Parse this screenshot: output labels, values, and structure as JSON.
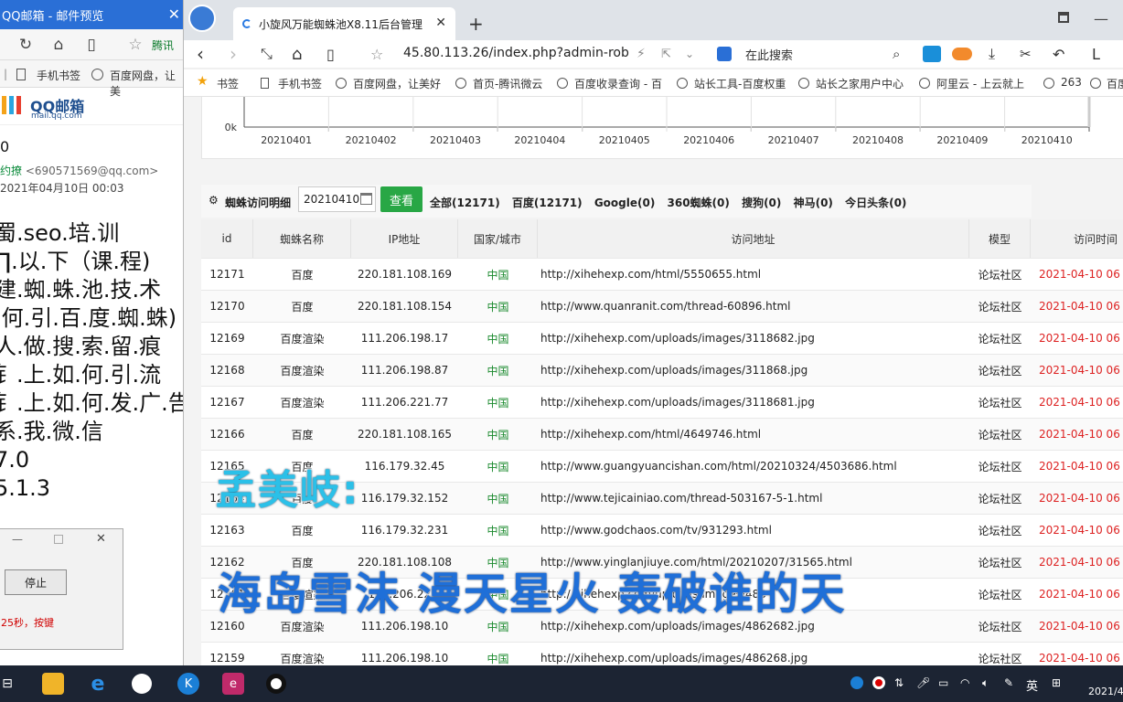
{
  "left_window": {
    "title": "QQ邮箱 - 邮件预览",
    "brand_cn": "QQ邮箱",
    "brand_url": "mail.qq.com",
    "bookmarks": [
      "手机书签",
      "百度网盘，让美"
    ],
    "fav_label": "腾讯",
    "subject_prefix": "0",
    "sender_name": "约撩",
    "sender_email": "<690571569@qq.com>",
    "date": "2021年04月10日 00:03",
    "body_lines": [
      "蜀.seo.培.训",
      "∏.以.下（课.程)",
      "建.蜘.蛛.池.技.术",
      ".何.引.百.度.蜘.蛛)",
      "人.做.搜.索.留.痕",
      "钅.上.如.何.引.流",
      "钅.上.如.何.发.广.告",
      "系.我.微.信",
      "7.0",
      "5.1.3"
    ],
    "dialog_button": "停止",
    "dialog_message": "25秒，按键"
  },
  "browser": {
    "tab_title": "小旋风万能蜘蛛池X8.11后台管理",
    "url": "45.80.113.26/index.php?admin-rob",
    "search_placeholder": "在此搜索",
    "bookmarks_label": "书签",
    "bookmarks": [
      "手机书签",
      "百度网盘，让美好",
      "首页-腾讯微云",
      "百度收录查询 - 百",
      "站长工具-百度权重",
      "站长之家用户中心",
      "阿里云 - 上云就上",
      "263",
      "百度"
    ]
  },
  "chart": {
    "y_tick": "0k",
    "x_labels": [
      "20210401",
      "20210402",
      "20210403",
      "20210404",
      "20210405",
      "20210406",
      "20210407",
      "20210408",
      "20210409",
      "20210410"
    ]
  },
  "toolbar": {
    "title": "蜘蛛访问明细",
    "date_value": "20210410",
    "view_button": "查看",
    "filters": [
      "全部(12171)",
      "百度(12171)",
      "Google(0)",
      "360蜘蛛(0)",
      "搜狗(0)",
      "神马(0)",
      "今日头条(0)"
    ]
  },
  "table": {
    "headers": [
      "id",
      "蜘蛛名称",
      "IP地址",
      "国家/城市",
      "访问地址",
      "模型",
      "访问时间"
    ],
    "rows": [
      [
        "12171",
        "百度",
        "220.181.108.169",
        "中国",
        "http://xihehexp.com/html/5550655.html",
        "论坛社区",
        "2021-04-10 06"
      ],
      [
        "12170",
        "百度",
        "220.181.108.154",
        "中国",
        "http://www.quanranit.com/thread-60896.html",
        "论坛社区",
        "2021-04-10 06"
      ],
      [
        "12169",
        "百度渲染",
        "111.206.198.17",
        "中国",
        "http://xihehexp.com/uploads/images/3118682.jpg",
        "论坛社区",
        "2021-04-10 06"
      ],
      [
        "12168",
        "百度渲染",
        "111.206.198.87",
        "中国",
        "http://xihehexp.com/uploads/images/311868.jpg",
        "论坛社区",
        "2021-04-10 06"
      ],
      [
        "12167",
        "百度渲染",
        "111.206.221.77",
        "中国",
        "http://xihehexp.com/uploads/images/3118681.jpg",
        "论坛社区",
        "2021-04-10 06"
      ],
      [
        "12166",
        "百度",
        "220.181.108.165",
        "中国",
        "http://xihehexp.com/html/4649746.html",
        "论坛社区",
        "2021-04-10 06"
      ],
      [
        "12165",
        "百度",
        "116.179.32.45",
        "中国",
        "http://www.guangyuancishan.com/html/20210324/4503686.html",
        "论坛社区",
        "2021-04-10 06"
      ],
      [
        "12164",
        "百度",
        "116.179.32.152",
        "中国",
        "http://www.tejicainiao.com/thread-503167-5-1.html",
        "论坛社区",
        "2021-04-10 06"
      ],
      [
        "12163",
        "百度",
        "116.179.32.231",
        "中国",
        "http://www.godchaos.com/tv/931293.html",
        "论坛社区",
        "2021-04-10 06"
      ],
      [
        "12162",
        "百度",
        "220.181.108.108",
        "中国",
        "http://www.yinglanjiuye.com/html/20210207/31565.html",
        "论坛社区",
        "2021-04-10 06"
      ],
      [
        "12161",
        "百度渲染",
        "111.206.221.",
        "中国",
        "http://xihehexp.com/uploads/images/486",
        "论坛社区",
        "2021-04-10 06"
      ],
      [
        "12160",
        "百度渲染",
        "111.206.198.10",
        "中国",
        "http://xihehexp.com/uploads/images/4862682.jpg",
        "论坛社区",
        "2021-04-10 06"
      ],
      [
        "12159",
        "百度渲染",
        "111.206.198.10",
        "中国",
        "http://xihehexp.com/uploads/images/486268.jpg",
        "论坛社区",
        "2021-04-10 06"
      ]
    ]
  },
  "subtitles": {
    "line1": "孟美岐:",
    "line2": "海岛雪沫 漫天星火 轰破谁的天"
  },
  "taskbar": {
    "ime": "英",
    "clock": "2021/4"
  }
}
